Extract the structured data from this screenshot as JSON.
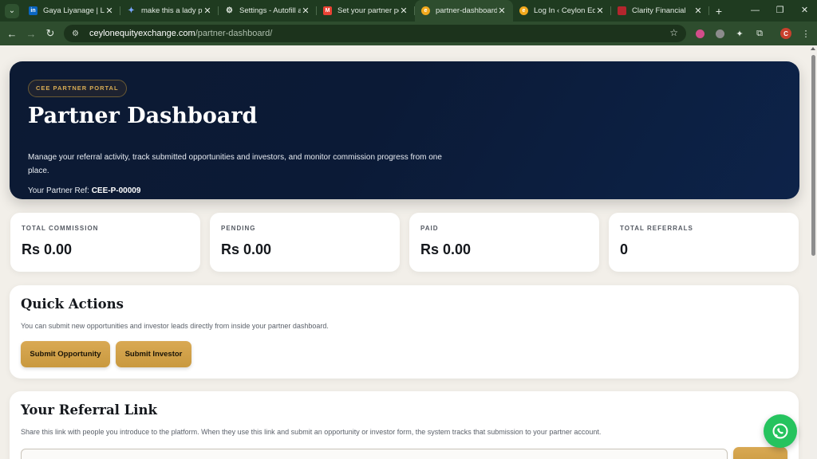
{
  "browser": {
    "tabs": [
      {
        "label": "Gaya Liyanage | Linke",
        "icon": "linkedin-icon",
        "color": "#0a66c2",
        "active": false
      },
      {
        "label": "make this a lady profe",
        "icon": "gemini-icon",
        "color": "#7aa7ff",
        "active": false
      },
      {
        "label": "Settings - Autofill and",
        "icon": "settings-gear-icon",
        "color": "#e3ebe3",
        "active": false
      },
      {
        "label": "Set your partner port",
        "icon": "gmail-icon",
        "color": "#ea4335",
        "active": false
      },
      {
        "label": "partner-dashboard -",
        "icon": "site-favicon-icon",
        "color": "#f2a91d",
        "active": true
      },
      {
        "label": "Log In ‹ Ceylon Equit",
        "icon": "site-favicon-icon",
        "color": "#f2a91d",
        "active": false
      },
      {
        "label": "Clarity Financial",
        "icon": "clarity-favicon-icon",
        "color": "#b3262d",
        "active": false
      }
    ],
    "url_domain": "ceylonequityexchange.com",
    "url_path": "/partner-dashboard/"
  },
  "hero": {
    "badge": "CEE PARTNER PORTAL",
    "title": "Partner Dashboard",
    "description": "Manage your referral activity, track submitted opportunities and investors, and monitor commission progress from one place.",
    "ref_label": "Your Partner Ref: ",
    "ref_value": "CEE-P-00009"
  },
  "stats": [
    {
      "label": "TOTAL COMMISSION",
      "value": "Rs 0.00"
    },
    {
      "label": "PENDING",
      "value": "Rs 0.00"
    },
    {
      "label": "PAID",
      "value": "Rs 0.00"
    },
    {
      "label": "TOTAL REFERRALS",
      "value": "0"
    }
  ],
  "quick_actions": {
    "title": "Quick Actions",
    "text": "You can submit new opportunities and investor leads directly from inside your partner dashboard.",
    "btn_opportunity": "Submit Opportunity",
    "btn_investor": "Submit Investor"
  },
  "referral": {
    "title": "Your Referral Link",
    "text": "Share this link with people you introduce to the platform. When they use this link and submit an opportunity or investor form, the system tracks that submission to your partner account."
  },
  "colors": {
    "accent_gold": "#d4a34c",
    "hero_navy": "#0b1a36",
    "whatsapp_green": "#25c35e"
  }
}
